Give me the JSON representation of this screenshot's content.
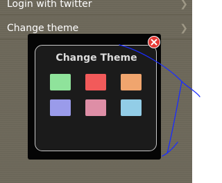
{
  "menu": {
    "items": [
      {
        "label": "Login with twitter"
      },
      {
        "label": "Change theme"
      }
    ]
  },
  "dialog": {
    "title": "Change Theme",
    "swatches": [
      {
        "color": "#8fe39b"
      },
      {
        "color": "#f25a5a"
      },
      {
        "color": "#f0a56e"
      },
      {
        "color": "#9a9bea"
      },
      {
        "color": "#de8ea6"
      },
      {
        "color": "#92cde7"
      }
    ]
  },
  "colors": {
    "background": "#6f6a5c",
    "dialog": "#050505",
    "close": "#e53935",
    "annotation": "#1a2cff"
  }
}
